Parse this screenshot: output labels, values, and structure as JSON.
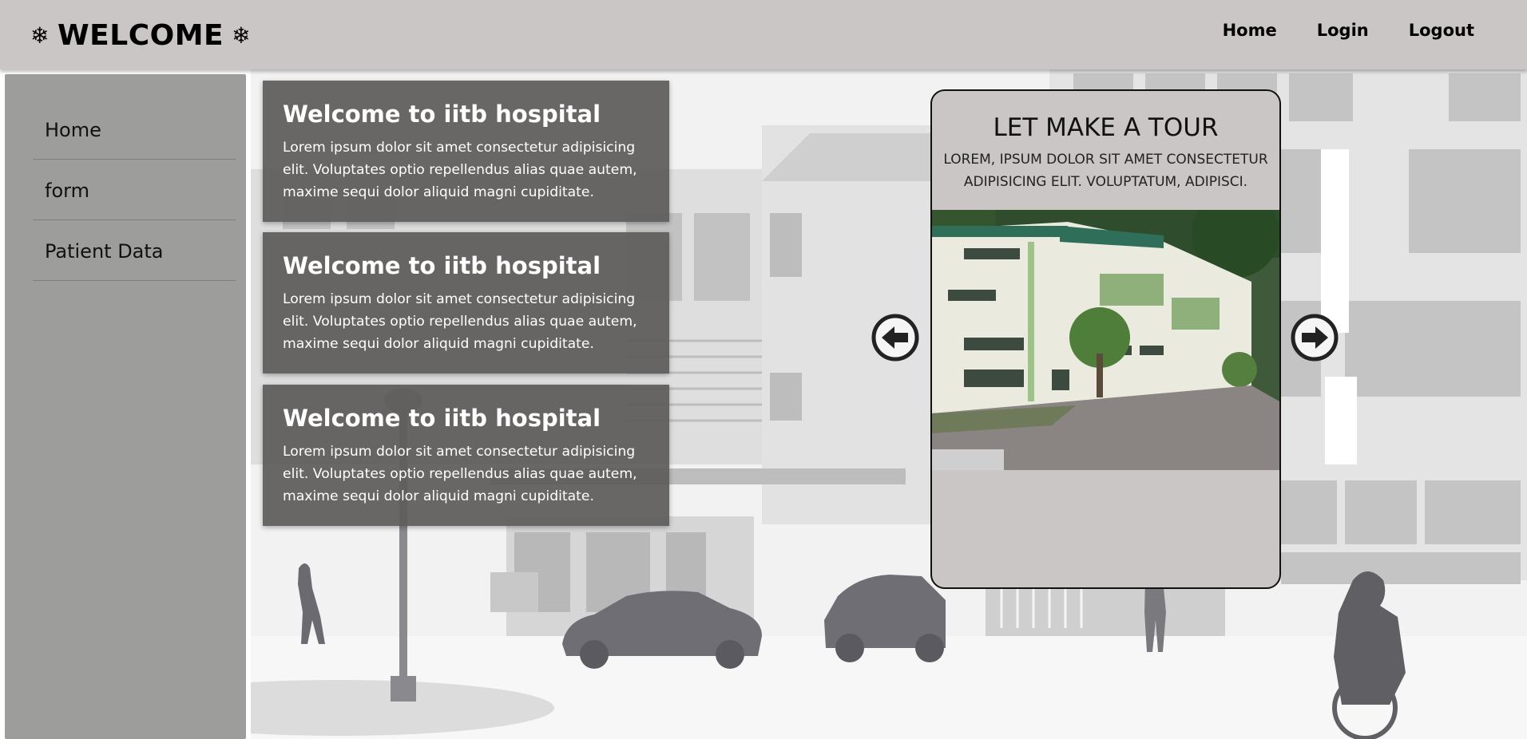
{
  "header": {
    "brand": "WELCOME",
    "brand_icon": "snowflake-icon",
    "nav": [
      "Home",
      "Login",
      "Logout"
    ]
  },
  "sidebar": {
    "items": [
      "Home",
      "form",
      "Patient Data"
    ]
  },
  "cards": [
    {
      "title": "Welcome to iitb hospital",
      "text": "Lorem ipsum dolor sit amet consectetur adipisicing elit. Voluptates optio repellendus alias quae autem, maxime sequi dolor aliquid magni cupiditate."
    },
    {
      "title": "Welcome to iitb hospital",
      "text": "Lorem ipsum dolor sit amet consectetur adipisicing elit. Voluptates optio repellendus alias quae autem, maxime sequi dolor aliquid magni cupiditate."
    },
    {
      "title": "Welcome to iitb hospital",
      "text": "Lorem ipsum dolor sit amet consectetur adipisicing elit. Voluptates optio repellendus alias quae autem, maxime sequi dolor aliquid magni cupiditate."
    }
  ],
  "tour": {
    "title": "LET MAKE A TOUR",
    "text": "LOREM, IPSUM DOLOR SIT AMET CONSECTETUR ADIPISICING ELIT. VOLUPTATUM, ADIPISCI.",
    "prev_icon": "arrow-left-circle-icon",
    "next_icon": "arrow-right-circle-icon"
  },
  "colors": {
    "header_bg": "#cbc6c6",
    "sidebar_bg": "#9d9d9b",
    "card_bg": "#605c5c",
    "tour_bg": "#cbc6c6"
  }
}
